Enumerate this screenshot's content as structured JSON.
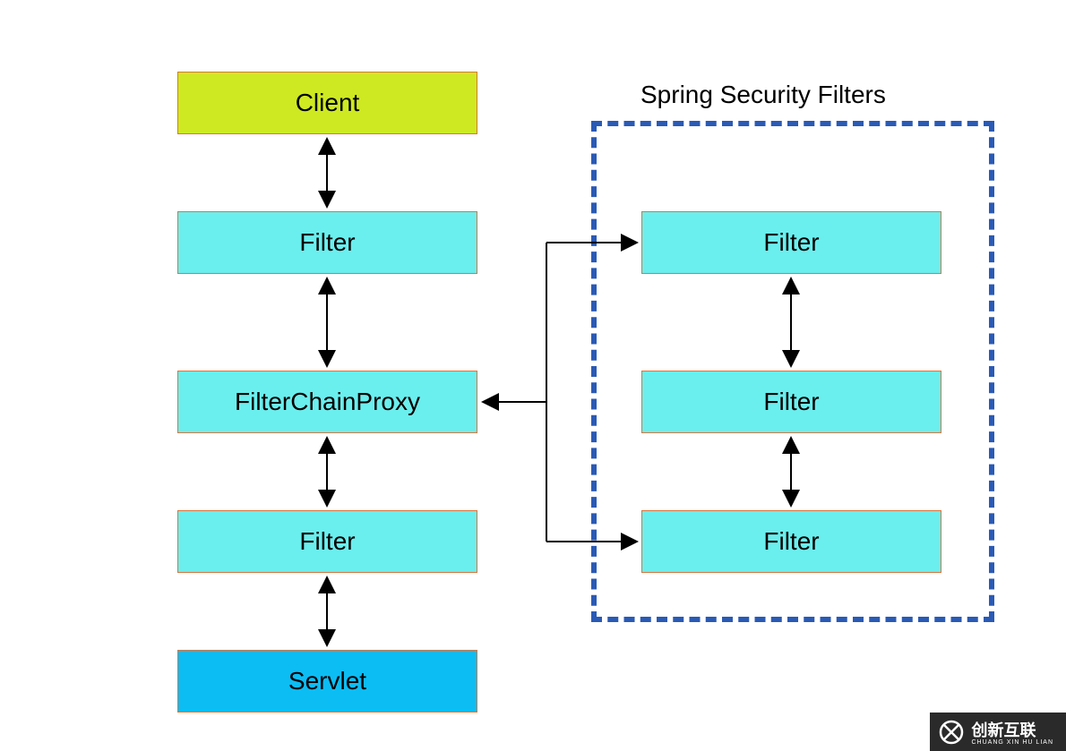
{
  "boxes": {
    "client": "Client",
    "filter_left_1": "Filter",
    "filter_chain_proxy": "FilterChainProxy",
    "filter_left_3": "Filter",
    "servlet": "Servlet",
    "filter_right_1": "Filter",
    "filter_right_2": "Filter",
    "filter_right_3": "Filter"
  },
  "container": {
    "title": "Spring Security Filters"
  },
  "watermark": {
    "brand": "创新互联",
    "sub": "CHUANG XIN HU LIAN"
  }
}
